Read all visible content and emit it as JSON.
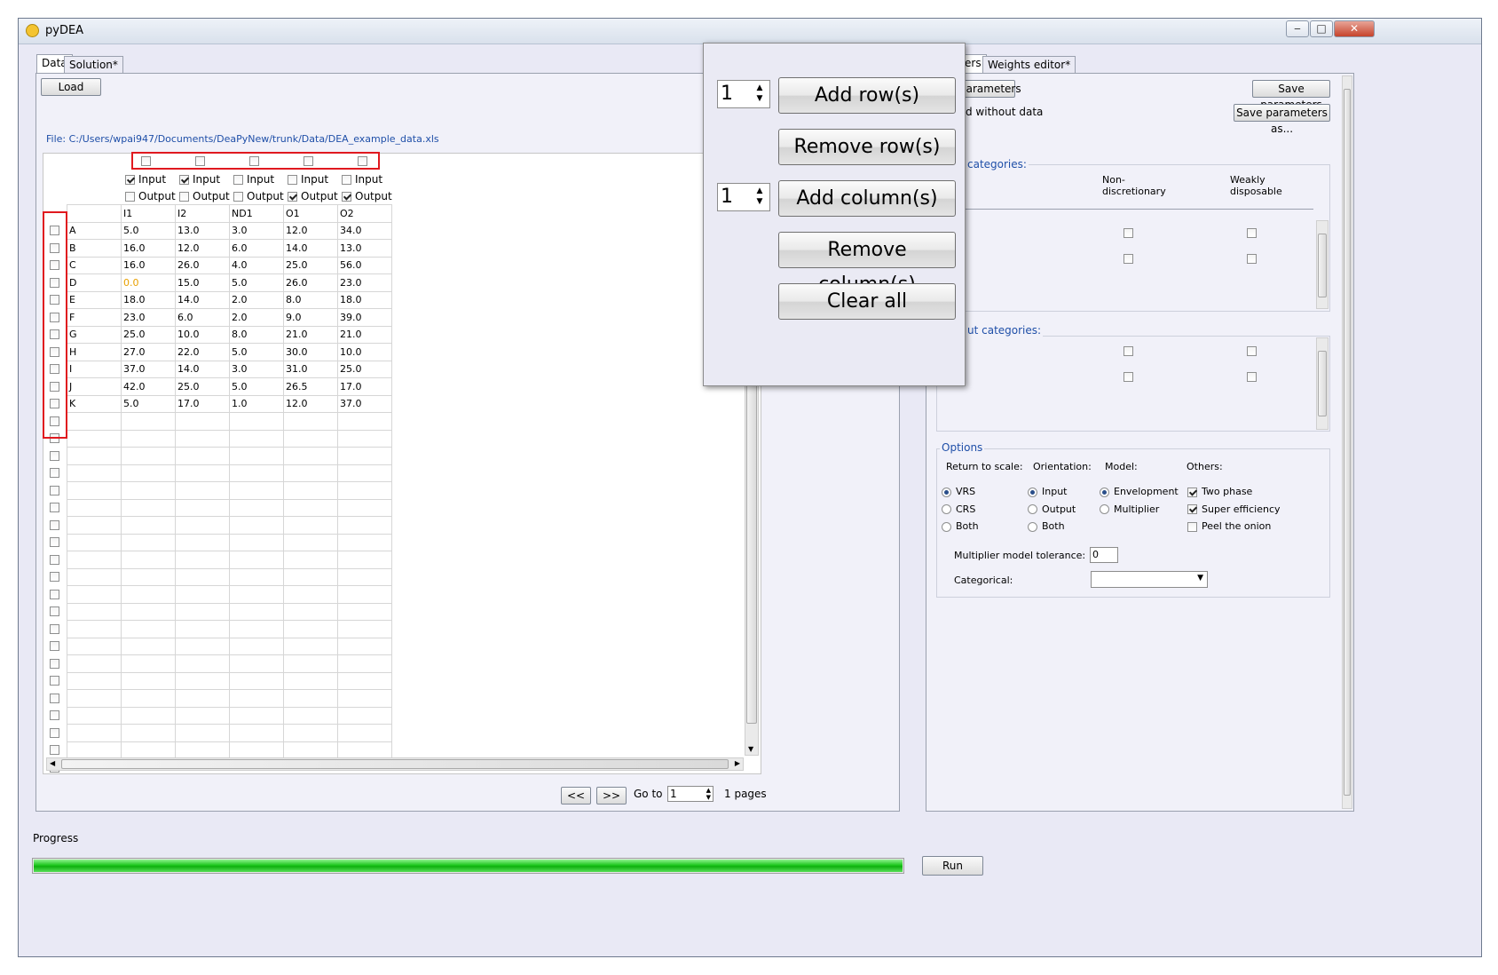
{
  "window": {
    "title": "pyDEA",
    "minimize": "‒",
    "maximize": "□",
    "close": "✕"
  },
  "left_tabs": [
    {
      "label": "Data"
    },
    {
      "label": "Solution*"
    }
  ],
  "right_tabs": [
    {
      "label": "ers"
    },
    {
      "label": "Weights editor*"
    }
  ],
  "load_button": "Load",
  "file_path": "File: C:/Users/wpai947/Documents/DeaPyNew/trunk/Data/DEA_example_data.xls",
  "columns": [
    {
      "name": "I1",
      "input": true,
      "output": false
    },
    {
      "name": "I2",
      "input": true,
      "output": false
    },
    {
      "name": "ND1",
      "input": false,
      "output": false
    },
    {
      "name": "O1",
      "input": false,
      "output": true
    },
    {
      "name": "O2",
      "input": false,
      "output": true
    }
  ],
  "input_label": "Input",
  "output_label": "Output",
  "rows": [
    {
      "name": "A",
      "values": [
        "5.0",
        "13.0",
        "3.0",
        "12.0",
        "34.0"
      ]
    },
    {
      "name": "B",
      "values": [
        "16.0",
        "12.0",
        "6.0",
        "14.0",
        "13.0"
      ]
    },
    {
      "name": "C",
      "values": [
        "16.0",
        "26.0",
        "4.0",
        "25.0",
        "56.0"
      ]
    },
    {
      "name": "D",
      "values": [
        "0.0",
        "15.0",
        "5.0",
        "26.0",
        "23.0"
      ]
    },
    {
      "name": "E",
      "values": [
        "18.0",
        "14.0",
        "2.0",
        "8.0",
        "18.0"
      ]
    },
    {
      "name": "F",
      "values": [
        "23.0",
        "6.0",
        "2.0",
        "9.0",
        "39.0"
      ]
    },
    {
      "name": "G",
      "values": [
        "25.0",
        "10.0",
        "8.0",
        "21.0",
        "21.0"
      ]
    },
    {
      "name": "H",
      "values": [
        "27.0",
        "22.0",
        "5.0",
        "30.0",
        "10.0"
      ]
    },
    {
      "name": "I",
      "values": [
        "37.0",
        "14.0",
        "3.0",
        "31.0",
        "25.0"
      ]
    },
    {
      "name": "J",
      "values": [
        "42.0",
        "25.0",
        "5.0",
        "26.5",
        "17.0"
      ]
    },
    {
      "name": "K",
      "values": [
        "5.0",
        "17.0",
        "1.0",
        "12.0",
        "37.0"
      ]
    }
  ],
  "empty_row_count": 20,
  "highlight_value_color": "#e8a000",
  "pager": {
    "prev": "<<",
    "next": ">>",
    "goto_label": "Go to",
    "goto_value": "1",
    "pages_label": "1 pages"
  },
  "params": {
    "load_params": "parameters",
    "save_params": "Save parameters",
    "save_params_as": "Save parameters as...",
    "without_data": "d without data",
    "input_categories": "categories:",
    "output_categories": "ut categories:",
    "col_non_disc": "Non-\ndiscretionary",
    "col_weakly": "Weakly\ndisposable"
  },
  "options": {
    "title": "Options",
    "rts_label": "Return to scale:",
    "orientation_label": "Orientation:",
    "model_label": "Model:",
    "others_label": "Others:",
    "rts": [
      {
        "label": "VRS",
        "checked": true
      },
      {
        "label": "CRS",
        "checked": false
      },
      {
        "label": "Both",
        "checked": false
      }
    ],
    "orientation": [
      {
        "label": "Input",
        "checked": true
      },
      {
        "label": "Output",
        "checked": false
      },
      {
        "label": "Both",
        "checked": false
      }
    ],
    "model": [
      {
        "label": "Envelopment",
        "checked": true
      },
      {
        "label": "Multiplier",
        "checked": false
      }
    ],
    "others": [
      {
        "label": "Two phase",
        "checked": true
      },
      {
        "label": "Super efficiency",
        "checked": true
      },
      {
        "label": "Peel the onion",
        "checked": false
      }
    ],
    "tolerance_label": "Multiplier model tolerance:",
    "tolerance_value": "0",
    "categorical_label": "Categorical:",
    "categorical_value": ""
  },
  "popup": {
    "row_spin": "1",
    "col_spin": "1",
    "add_rows": "Add row(s)",
    "remove_rows": "Remove row(s)",
    "add_columns": "Add column(s)",
    "remove_columns": "Remove column(s)",
    "clear_all": "Clear all"
  },
  "progress": {
    "label": "Progress",
    "value": 1.0
  },
  "run_button": "Run",
  "colors": {
    "highlight_box": "#e0191f",
    "progress_fill": "#1fc71f",
    "link_blue": "#1f4fa8"
  }
}
